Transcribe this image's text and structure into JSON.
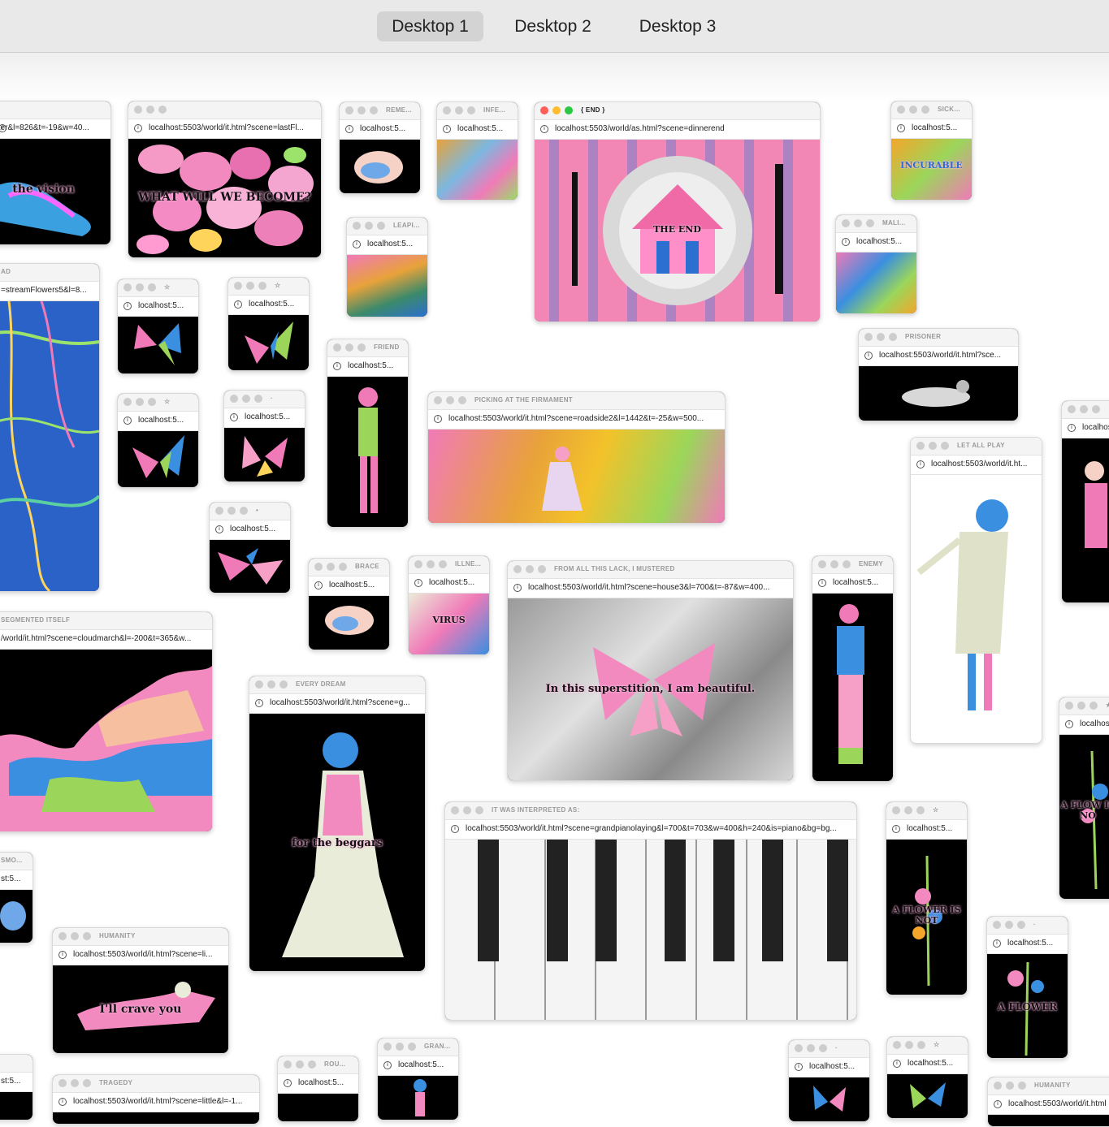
{
  "desktops": [
    {
      "label": "Desktop 1",
      "active": true
    },
    {
      "label": "Desktop 2",
      "active": false
    },
    {
      "label": "Desktop 3",
      "active": false
    }
  ],
  "windows": {
    "w_vision": {
      "title": "",
      "url": "tter&l=826&t=-19&w=40...",
      "caption": "the vision"
    },
    "w_become": {
      "title": "",
      "url": "localhost:5503/world/it.html?scene=lastFl...",
      "caption": "WHAT WILL WE BECOME?"
    },
    "w_reme": {
      "title": "REME...",
      "url": "localhost:5..."
    },
    "w_infe": {
      "title": "INFE...",
      "url": "localhost:5..."
    },
    "w_end": {
      "title": "{ END }",
      "url": "localhost:5503/world/as.html?scene=dinnerend",
      "caption": "THE END"
    },
    "w_sick": {
      "title": "SICK...",
      "url": "localhost:5...",
      "caption": "INCURABLE"
    },
    "w_leapi": {
      "title": "LEAPI...",
      "url": "localhost:5..."
    },
    "w_mali": {
      "title": "MALI...",
      "url": "localhost:5..."
    },
    "w_stream": {
      "title": "AD",
      "url": "=streamFlowers5&l=8..."
    },
    "w_bf1": {
      "title": "☆",
      "url": "localhost:5..."
    },
    "w_bf2": {
      "title": "☆",
      "url": "localhost:5..."
    },
    "w_bf3": {
      "title": "☆",
      "url": "localhost:5..."
    },
    "w_bf4": {
      "title": "·",
      "url": "localhost:5..."
    },
    "w_bf5": {
      "title": "•",
      "url": "localhost:5..."
    },
    "w_friend": {
      "title": "FRIEND",
      "url": "localhost:5..."
    },
    "w_firmament": {
      "title": "PICKING AT THE FIRMAMENT",
      "url": "localhost:5503/world/it.html?scene=roadside2&l=1442&t=-25&w=500..."
    },
    "w_prisoner": {
      "title": "PRISONER",
      "url": "localhost:5503/world/it.html?sce..."
    },
    "w_letall": {
      "title": "LET ALL PLAY",
      "url": "localhost:5503/world/it.ht..."
    },
    "w_edge_r1": {
      "title": "",
      "url": "localhost"
    },
    "w_segmented": {
      "title": "SEGMENTED ITSELF",
      "url": "/world/it.html?scene=cloudmarch&l=-200&t=365&w..."
    },
    "w_brace": {
      "title": "BRACE",
      "url": "localhost:5..."
    },
    "w_illne": {
      "title": "ILLNE...",
      "url": "localhost:5...",
      "caption": "VIRUS"
    },
    "w_lack": {
      "title": "FROM ALL THIS LACK, I MUSTERED",
      "url": "localhost:5503/world/it.html?scene=house3&l=700&t=-87&w=400...",
      "caption": "In this superstition, I am beautiful."
    },
    "w_enemy": {
      "title": "ENEMY",
      "url": "localhost:5..."
    },
    "w_dream": {
      "title": "EVERY DREAM",
      "url": "localhost:5503/world/it.html?scene=g...",
      "caption": "for the beggars"
    },
    "w_interpreted": {
      "title": "IT WAS INTERPRETED AS:",
      "url": "localhost:5503/world/it.html?scene=grandpianolaying&l=700&t=703&w=400&h=240&is=piano&bg=bg..."
    },
    "w_flower1": {
      "title": "☆",
      "url": "localhost:5...",
      "caption": "A FLOWER IS NOT"
    },
    "w_edge_r2": {
      "title": "★",
      "url": "localhos",
      "caption": "A FLOW IS NO"
    },
    "w_smo": {
      "title": "SMO...",
      "url": "st:5..."
    },
    "w_humanity": {
      "title": "HUMANITY",
      "url": "localhost:5503/world/it.html?scene=li...",
      "caption": "I'll crave you"
    },
    "w_flower2": {
      "title": "·",
      "url": "localhost:5...",
      "caption": "A FLOWER"
    },
    "w_edge_l": {
      "title": "",
      "url": "st:5..."
    },
    "w_tragedy": {
      "title": "TRAGEDY",
      "url": "localhost:5503/world/it.html?scene=little&l=-1..."
    },
    "w_rou": {
      "title": "ROU...",
      "url": "localhost:5..."
    },
    "w_gran": {
      "title": "GRAN...",
      "url": "localhost:5..."
    },
    "w_b1": {
      "title": "·",
      "url": "localhost:5..."
    },
    "w_b2": {
      "title": "☆",
      "url": "localhost:5..."
    },
    "w_humanity2": {
      "title": "HUMANITY",
      "url": "localhost:5503/world/it.html"
    }
  }
}
